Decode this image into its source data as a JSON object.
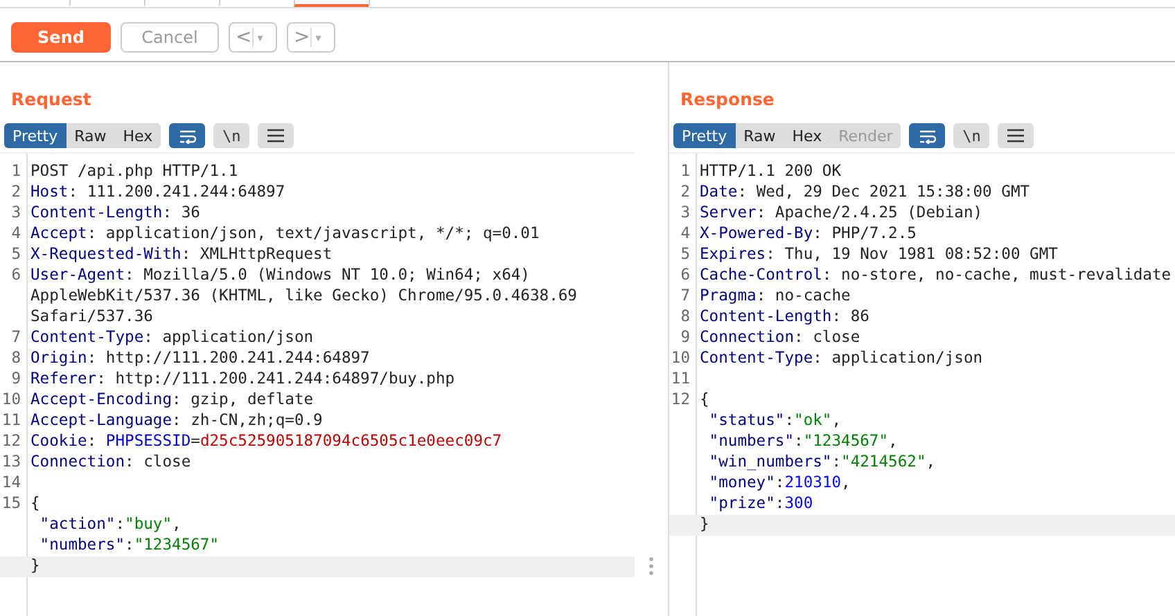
{
  "top_tabs": [
    {
      "selected": false
    },
    {
      "selected": false
    },
    {
      "selected": false
    },
    {
      "selected": true
    },
    {
      "selected": false
    }
  ],
  "toolbar": {
    "send": "Send",
    "cancel": "Cancel",
    "back": "<",
    "back_menu": "▾",
    "forward": ">",
    "forward_menu": "▾"
  },
  "request": {
    "title": "Request",
    "views": [
      {
        "label": "Pretty",
        "selected": true,
        "disabled": false
      },
      {
        "label": "Raw",
        "selected": false,
        "disabled": false
      },
      {
        "label": "Hex",
        "selected": false,
        "disabled": false
      }
    ],
    "wrap_on": true,
    "newline_label": "\\n",
    "lines": [
      {
        "number": "1",
        "segments": [
          {
            "kind": "text",
            "text": "POST /api.php HTTP/1.1"
          }
        ]
      },
      {
        "number": "2",
        "segments": [
          {
            "kind": "name",
            "text": "Host"
          },
          {
            "kind": "text",
            "text": ": 111.200.241.244:64897"
          }
        ]
      },
      {
        "number": "3",
        "segments": [
          {
            "kind": "name",
            "text": "Content-Length"
          },
          {
            "kind": "text",
            "text": ": 36"
          }
        ]
      },
      {
        "number": "4",
        "segments": [
          {
            "kind": "name",
            "text": "Accept"
          },
          {
            "kind": "text",
            "text": ": application/json, text/javascript, */*; q=0.01"
          }
        ]
      },
      {
        "number": "5",
        "segments": [
          {
            "kind": "name",
            "text": "X-Requested-With"
          },
          {
            "kind": "text",
            "text": ": XMLHttpRequest"
          }
        ]
      },
      {
        "number": "6",
        "segments": [
          {
            "kind": "name",
            "text": "User-Agent"
          },
          {
            "kind": "text",
            "text": ": Mozilla/5.0 (Windows NT 10.0; Win64; x64)"
          }
        ]
      },
      {
        "segments": [
          {
            "kind": "text",
            "text": "AppleWebKit/537.36 (KHTML, like Gecko) Chrome/95.0.4638.69"
          }
        ]
      },
      {
        "segments": [
          {
            "kind": "text",
            "text": "Safari/537.36"
          }
        ]
      },
      {
        "number": "7",
        "segments": [
          {
            "kind": "name",
            "text": "Content-Type"
          },
          {
            "kind": "text",
            "text": ": application/json"
          }
        ]
      },
      {
        "number": "8",
        "segments": [
          {
            "kind": "name",
            "text": "Origin"
          },
          {
            "kind": "text",
            "text": ": http://111.200.241.244:64897"
          }
        ]
      },
      {
        "number": "9",
        "segments": [
          {
            "kind": "name",
            "text": "Referer"
          },
          {
            "kind": "text",
            "text": ": http://111.200.241.244:64897/buy.php"
          }
        ]
      },
      {
        "number": "10",
        "segments": [
          {
            "kind": "name",
            "text": "Accept-Encoding"
          },
          {
            "kind": "text",
            "text": ": gzip, deflate"
          }
        ]
      },
      {
        "number": "11",
        "segments": [
          {
            "kind": "name",
            "text": "Accept-Language"
          },
          {
            "kind": "text",
            "text": ": zh-CN,zh;q=0.9"
          }
        ]
      },
      {
        "number": "12",
        "segments": [
          {
            "kind": "name",
            "text": "Cookie"
          },
          {
            "kind": "text",
            "text": ": "
          },
          {
            "kind": "param",
            "text": "PHPSESSID"
          },
          {
            "kind": "text",
            "text": "="
          },
          {
            "kind": "value",
            "text": "d25c525905187094c6505c1e0eec09c7"
          }
        ]
      },
      {
        "number": "13",
        "segments": [
          {
            "kind": "name",
            "text": "Connection"
          },
          {
            "kind": "text",
            "text": ": close"
          }
        ]
      },
      {
        "number": "14"
      },
      {
        "number": "15",
        "segments": [
          {
            "kind": "text",
            "text": "{"
          }
        ]
      },
      {
        "segments": [
          {
            "kind": "key",
            "text": " \"action\""
          },
          {
            "kind": "text",
            "text": ":"
          },
          {
            "kind": "string",
            "text": "\"buy\""
          },
          {
            "kind": "text",
            "text": ","
          }
        ]
      },
      {
        "segments": [
          {
            "kind": "key",
            "text": " \"numbers\""
          },
          {
            "kind": "text",
            "text": ":"
          },
          {
            "kind": "string",
            "text": "\"1234567\""
          }
        ]
      },
      {
        "segments": [
          {
            "kind": "text",
            "text": "}"
          }
        ],
        "current": true
      }
    ]
  },
  "response": {
    "title": "Response",
    "views": [
      {
        "label": "Pretty",
        "selected": true,
        "disabled": false
      },
      {
        "label": "Raw",
        "selected": false,
        "disabled": false
      },
      {
        "label": "Hex",
        "selected": false,
        "disabled": false
      },
      {
        "label": "Render",
        "selected": false,
        "disabled": true
      }
    ],
    "wrap_on": true,
    "newline_label": "\\n",
    "lines": [
      {
        "number": "1",
        "segments": [
          {
            "kind": "text",
            "text": "HTTP/1.1 200 OK"
          }
        ]
      },
      {
        "number": "2",
        "segments": [
          {
            "kind": "name",
            "text": "Date"
          },
          {
            "kind": "text",
            "text": ": Wed, 29 Dec 2021 15:38:00 GMT"
          }
        ]
      },
      {
        "number": "3",
        "segments": [
          {
            "kind": "name",
            "text": "Server"
          },
          {
            "kind": "text",
            "text": ": Apache/2.4.25 (Debian)"
          }
        ]
      },
      {
        "number": "4",
        "segments": [
          {
            "kind": "name",
            "text": "X-Powered-By"
          },
          {
            "kind": "text",
            "text": ": PHP/7.2.5"
          }
        ]
      },
      {
        "number": "5",
        "segments": [
          {
            "kind": "name",
            "text": "Expires"
          },
          {
            "kind": "text",
            "text": ": Thu, 19 Nov 1981 08:52:00 GMT"
          }
        ]
      },
      {
        "number": "6",
        "segments": [
          {
            "kind": "name",
            "text": "Cache-Control"
          },
          {
            "kind": "text",
            "text": ": no-store, no-cache, must-revalidate"
          }
        ]
      },
      {
        "number": "7",
        "segments": [
          {
            "kind": "name",
            "text": "Pragma"
          },
          {
            "kind": "text",
            "text": ": no-cache"
          }
        ]
      },
      {
        "number": "8",
        "segments": [
          {
            "kind": "name",
            "text": "Content-Length"
          },
          {
            "kind": "text",
            "text": ": 86"
          }
        ]
      },
      {
        "number": "9",
        "segments": [
          {
            "kind": "name",
            "text": "Connection"
          },
          {
            "kind": "text",
            "text": ": close"
          }
        ]
      },
      {
        "number": "10",
        "segments": [
          {
            "kind": "name",
            "text": "Content-Type"
          },
          {
            "kind": "text",
            "text": ": application/json"
          }
        ]
      },
      {
        "number": "11"
      },
      {
        "number": "12",
        "segments": [
          {
            "kind": "text",
            "text": "{"
          }
        ]
      },
      {
        "segments": [
          {
            "kind": "key",
            "text": " \"status\""
          },
          {
            "kind": "text",
            "text": ":"
          },
          {
            "kind": "string",
            "text": "\"ok\""
          },
          {
            "kind": "text",
            "text": ","
          }
        ]
      },
      {
        "segments": [
          {
            "kind": "key",
            "text": " \"numbers\""
          },
          {
            "kind": "text",
            "text": ":"
          },
          {
            "kind": "string",
            "text": "\"1234567\""
          },
          {
            "kind": "text",
            "text": ","
          }
        ]
      },
      {
        "segments": [
          {
            "kind": "key",
            "text": " \"win_numbers\""
          },
          {
            "kind": "text",
            "text": ":"
          },
          {
            "kind": "string",
            "text": "\"4214562\""
          },
          {
            "kind": "text",
            "text": ","
          }
        ]
      },
      {
        "segments": [
          {
            "kind": "key",
            "text": " \"money\""
          },
          {
            "kind": "text",
            "text": ":"
          },
          {
            "kind": "number",
            "text": "210310"
          },
          {
            "kind": "text",
            "text": ","
          }
        ]
      },
      {
        "segments": [
          {
            "kind": "key",
            "text": " \"prize\""
          },
          {
            "kind": "text",
            "text": ":"
          },
          {
            "kind": "number",
            "text": "300"
          }
        ]
      },
      {
        "segments": [
          {
            "kind": "text",
            "text": "}"
          }
        ],
        "current": true
      }
    ]
  }
}
